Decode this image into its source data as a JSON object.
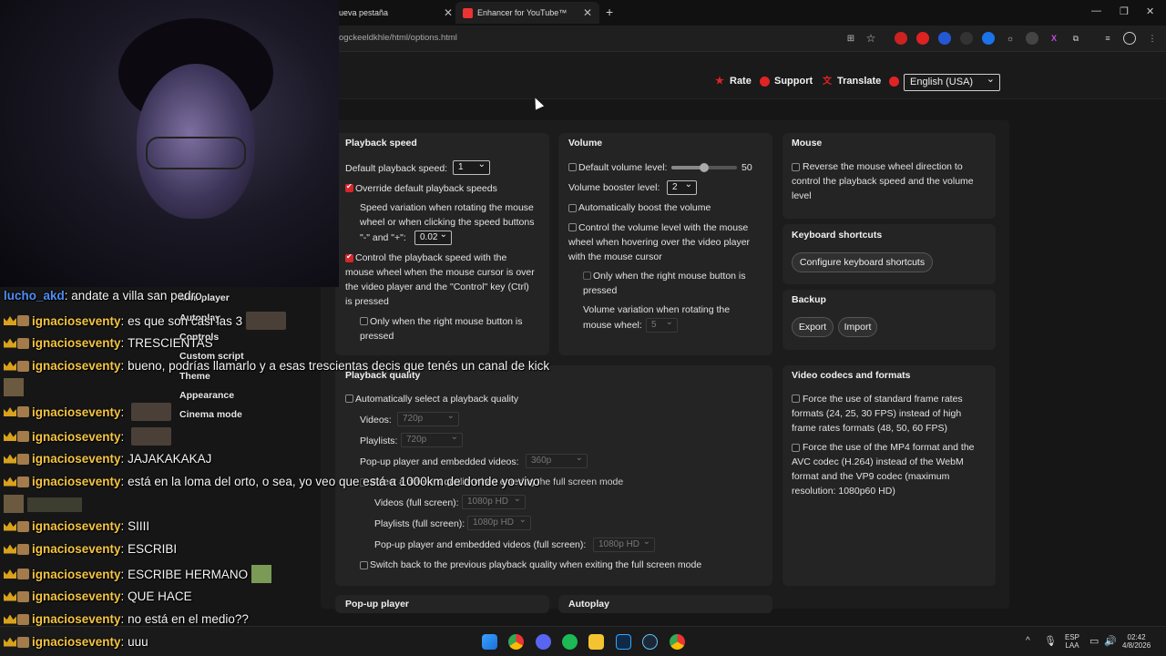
{
  "tabs": [
    {
      "label": "ueva pestaña"
    },
    {
      "label": "Enhancer for YouTube™"
    }
  ],
  "address": {
    "url": "ogckeeldkhle/html/options.html"
  },
  "top_links": {
    "rate": "Rate",
    "support": "Support",
    "translate": "Translate",
    "language": "English (USA)"
  },
  "playback_speed": {
    "title": "Playback speed",
    "default_label": "Default playback speed:",
    "default_value": "1",
    "override_label": "Override default playback speeds",
    "variation_text_1": "Speed variation when rotating the mouse",
    "variation_text_2": "wheel or when clicking the speed buttons",
    "variation_text_3": "\"-\" and \"+\":",
    "variation_value": "0.02",
    "control_text_1": "Control the playback speed with the",
    "control_text_2": "mouse wheel when the mouse cursor is over",
    "control_text_3": "the video player and the \"Control\" key (Ctrl)",
    "control_text_4": "is pressed",
    "right_btn_text_1": "Only when the right mouse button is",
    "right_btn_text_2": "pressed"
  },
  "volume": {
    "title": "Volume",
    "default_label": "Default volume level:",
    "default_value": "50",
    "slider_level": 0.5,
    "booster_label": "Volume booster level:",
    "booster_value": "2",
    "auto_boost": "Automatically boost the volume",
    "control_text_1": "Control the volume level with the mouse",
    "control_text_2": "wheel when hovering over the video player",
    "control_text_3": "with the mouse cursor",
    "right_btn_text_1": "Only when the right mouse button is",
    "right_btn_text_2": "pressed",
    "variation_text_1": "Volume variation when rotating the",
    "variation_text_2": "mouse wheel:",
    "variation_value": "5"
  },
  "mouse": {
    "title": "Mouse",
    "reverse_text_1": "Reverse the mouse wheel direction to",
    "reverse_text_2": "control the playback speed and the volume",
    "reverse_text_3": "level"
  },
  "keyboard": {
    "title": "Keyboard shortcuts",
    "configure": "Configure keyboard shortcuts"
  },
  "backup": {
    "title": "Backup",
    "export": "Export",
    "import": "Import"
  },
  "quality": {
    "title": "Playback quality",
    "auto_label": "Automatically select a playback quality",
    "videos_label": "Videos:",
    "videos_value": "720p",
    "playlists_label": "Playlists:",
    "playlists_value": "720p",
    "popup_label": "Pop-up player and embedded videos:",
    "popup_value": "360p",
    "fullscreen_label": "Select a different quality when entering the full screen mode",
    "videos_fs_label": "Videos (full screen):",
    "videos_fs_value": "1080p HD",
    "playlists_fs_label": "Playlists (full screen):",
    "playlists_fs_value": "1080p HD",
    "popup_fs_label": "Pop-up player and embedded videos (full screen):",
    "popup_fs_value": "1080p HD",
    "switch_back_label": "Switch back to the previous playback quality when exiting the full screen mode"
  },
  "codecs": {
    "title": "Video codecs and formats",
    "fps_text_1": "Force the use of standard frame rates",
    "fps_text_2": "formats (24, 25, 30 FPS) instead of high",
    "fps_text_3": "frame rates formats (48, 50, 60 FPS)",
    "mp4_text_1": "Force the use of the MP4 format and the",
    "mp4_text_2": "AVC codec (H.264) instead of the WebM",
    "mp4_text_3": "format and the VP9 codec (maximum",
    "mp4_text_4": "resolution: 1080p60 HD)"
  },
  "bottom_titles": {
    "popup": "Pop-up player",
    "autoplay": "Autoplay"
  },
  "sidebar_menu": [
    "Mini player",
    "Autoplay",
    "Controls",
    "Custom script",
    "Theme",
    "Appearance",
    "Cinema mode"
  ],
  "chat": [
    {
      "user": "lucho_akd",
      "text": "andate a villa san pedro"
    },
    {
      "user": "ignacioseventy",
      "text": "es que son casi las 3"
    },
    {
      "user": "ignacioseventy",
      "text": "TRESCIENTAS"
    },
    {
      "user": "ignacioseventy",
      "text": "bueno, podrías llamarlo y a esas trescientas decis que tenés un canal de kick"
    },
    {
      "user": "ignacioseventy",
      "text": ""
    },
    {
      "user": "ignacioseventy",
      "text": ""
    },
    {
      "user": "ignacioseventy",
      "text": "JAJAKAKAKAJ"
    },
    {
      "user": "ignacioseventy",
      "text": "está en la loma del orto, o sea, yo veo que está a 1000km de donde yo vivo"
    },
    {
      "user": "ignacioseventy",
      "text": "SIIII"
    },
    {
      "user": "ignacioseventy",
      "text": "ESCRIBI"
    },
    {
      "user": "ignacioseventy",
      "text": "ESCRIBE HERMANO"
    },
    {
      "user": "ignacioseventy",
      "text": "QUE HACE"
    },
    {
      "user": "ignacioseventy",
      "text": "no está en el medio??"
    },
    {
      "user": "ignacioseventy",
      "text": "uuu"
    }
  ],
  "tray": {
    "lang_1": "ESP",
    "lang_2": "LAA",
    "time": "02:42",
    "date": "4/8/2026"
  },
  "colors": {
    "accent": "#d7262b",
    "bg": "#161616",
    "card": "#242424"
  }
}
